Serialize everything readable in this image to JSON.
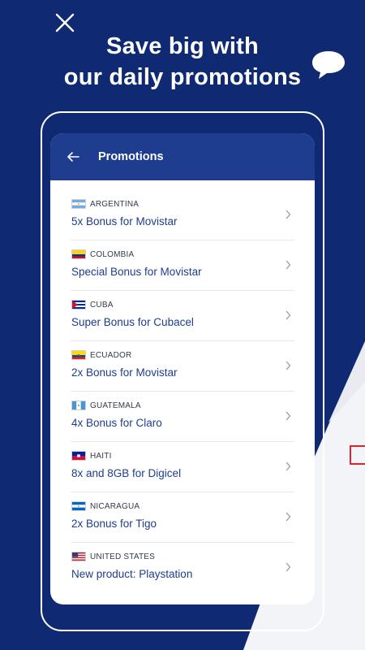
{
  "headline": {
    "line1": "Save big with",
    "line2": "our daily promotions"
  },
  "icons": {
    "close": "close-icon",
    "chat": "chat-bubble-icon",
    "back": "arrow-left-icon",
    "chevron": "chevron-right-icon"
  },
  "colors": {
    "background": "#0f2a72",
    "header": "#1e3d8f",
    "promo_text": "#1e3d8f",
    "accent_red": "#d4272f"
  },
  "app": {
    "header_title": "Promotions"
  },
  "promotions": [
    {
      "country": "ARGENTINA",
      "title": "5x Bonus for Movistar",
      "flag": "argentina"
    },
    {
      "country": "COLOMBIA",
      "title": "Special Bonus for Movistar",
      "flag": "colombia"
    },
    {
      "country": "CUBA",
      "title": "Super Bonus for Cubacel",
      "flag": "cuba"
    },
    {
      "country": "ECUADOR",
      "title": "2x Bonus for Movistar",
      "flag": "ecuador"
    },
    {
      "country": "GUATEMALA",
      "title": "4x Bonus for Claro",
      "flag": "guatemala"
    },
    {
      "country": "HAITI",
      "title": "8x and 8GB for Digicel",
      "flag": "haiti"
    },
    {
      "country": "NICARAGUA",
      "title": "2x Bonus for Tigo",
      "flag": "nicaragua"
    },
    {
      "country": "UNITED STATES",
      "title": "New product: Playstation",
      "flag": "united-states"
    }
  ]
}
